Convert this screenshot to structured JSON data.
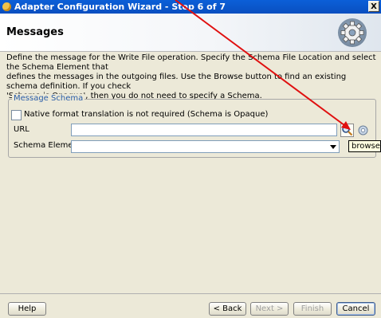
{
  "window": {
    "title": "Adapter Configuration Wizard - Step 6 of 7",
    "close_label": "X"
  },
  "header": {
    "title": "Messages",
    "graphic_icon": "gear-icon"
  },
  "description": {
    "line1": "Define the message for the Write File operation.  Specify the Schema File Location and select the Schema Element that",
    "line2": "defines the messages in the outgoing files. Use the Browse button to find an existing schema definition. If you check",
    "line3": "'Schema is Opaque', then you do not need to specify a Schema."
  },
  "message_schema": {
    "legend": "Message Schema",
    "opaque_checkbox": {
      "label": "Native format translation is not required (Schema is Opaque)",
      "checked": false
    },
    "url": {
      "label": "URL",
      "value": ""
    },
    "schema_element": {
      "label": "Schema Element",
      "selected": ""
    },
    "browse_icon": "magnifier-icon",
    "refresh_icon": "refresh-icon",
    "tooltip": "browse fo"
  },
  "buttons": {
    "help": "Help",
    "back": "< Back",
    "next": "Next >",
    "finish": "Finish",
    "cancel": "Cancel"
  }
}
